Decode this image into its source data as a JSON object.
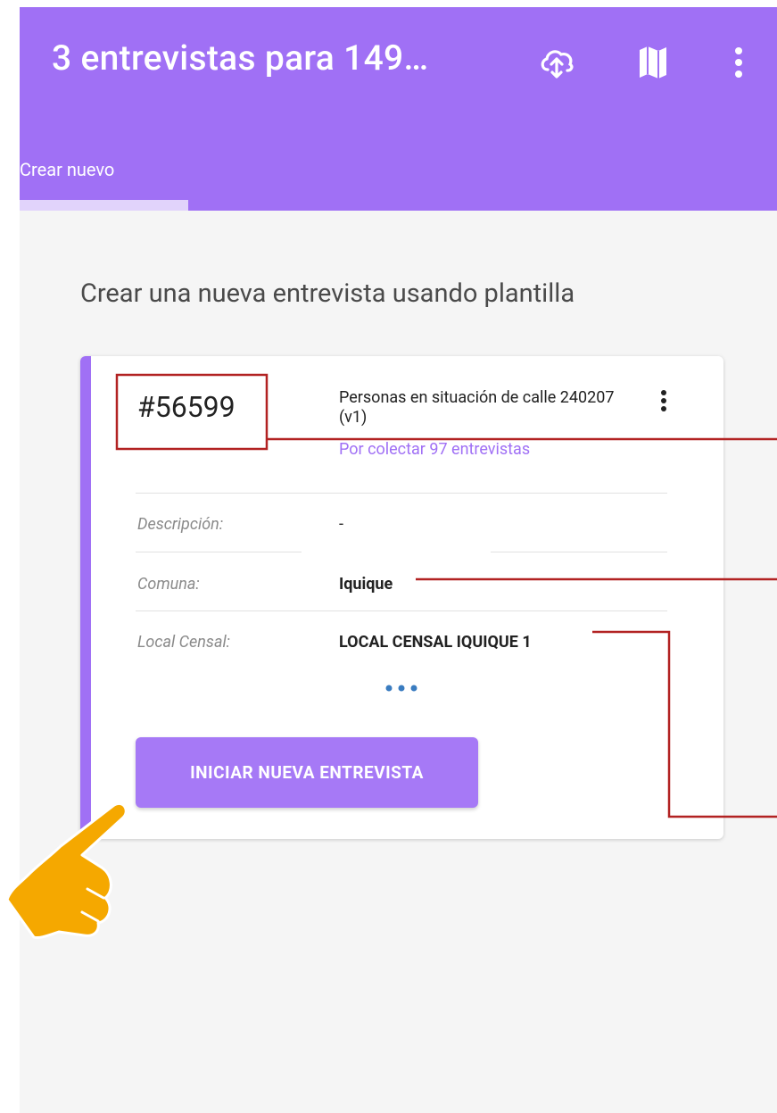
{
  "appbar": {
    "title": "3 entrevistas para 149…",
    "icons": [
      "cloud-sync-icon",
      "map-icon",
      "more-vert-icon"
    ],
    "background_color": "#a070f5"
  },
  "tabs": [
    {
      "label": "Crear nuevo",
      "selected": true
    }
  ],
  "main": {
    "heading": "Crear una nueva entrevista usando plantilla"
  },
  "template_card": {
    "id": "#56599",
    "name": "Personas en situación de calle 240207 (v1)",
    "status": "Por colectar 97 entrevistas",
    "fields": [
      {
        "label": "Descripción:",
        "value": "-"
      },
      {
        "label": "Comuna:",
        "value": "Iquique"
      },
      {
        "label": "Local Censal:",
        "value": "LOCAL CENSAL IQUIQUE 1"
      }
    ],
    "start_button_label": "INICIAR NUEVA ENTREVISTA"
  },
  "annotations": {
    "box_color": "#b22222",
    "pointer_icon": "pointing-hand-icon",
    "pointer_color": "#f5a800"
  }
}
